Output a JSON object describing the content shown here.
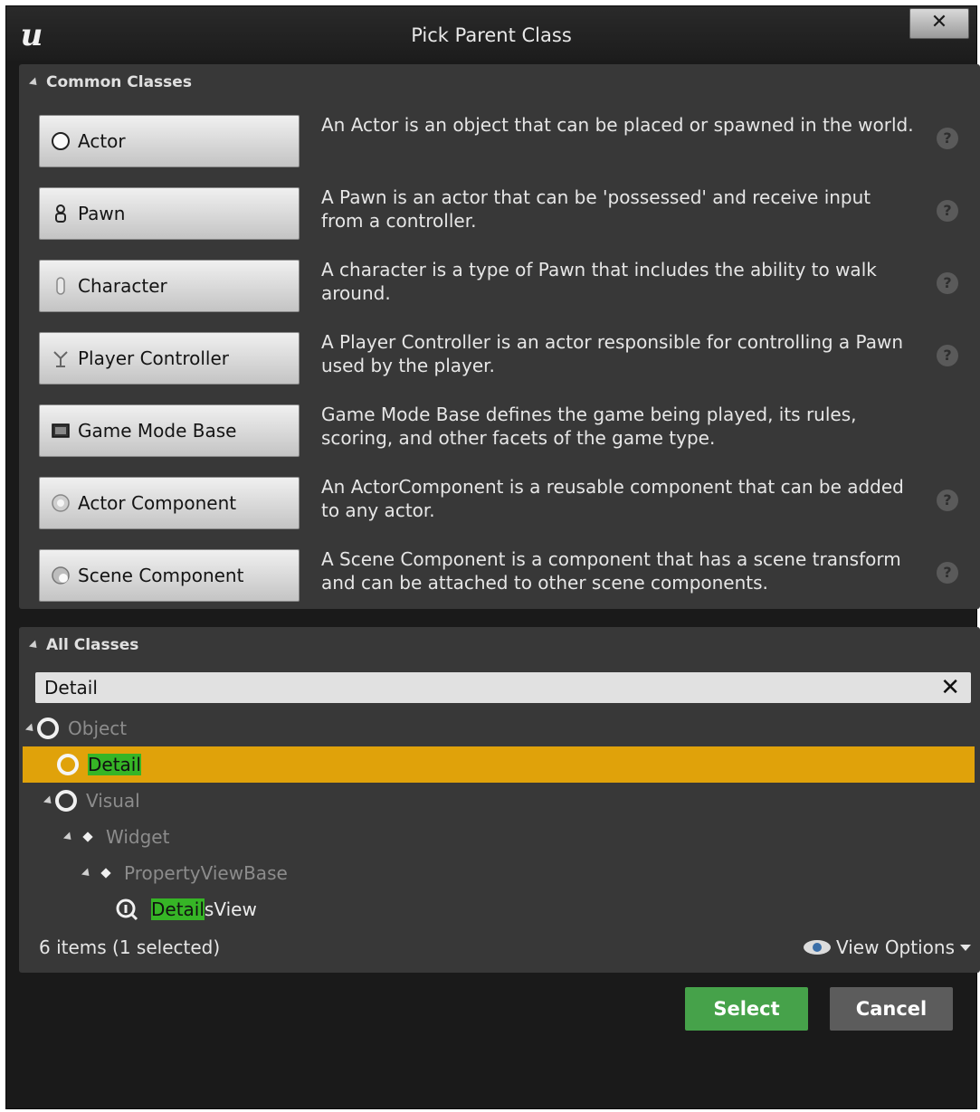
{
  "window": {
    "title": "Pick Parent Class",
    "close_label": "✕",
    "logo_glyph": "u"
  },
  "common": {
    "header": "Common Classes",
    "classes": [
      {
        "label": "Actor",
        "icon": "sphere-icon",
        "description": "An Actor is an object that can be placed or spawned in the world.",
        "help": true
      },
      {
        "label": "Pawn",
        "icon": "pawn-icon",
        "description": "A Pawn is an actor that can be 'possessed' and receive input from a controller.",
        "help": true
      },
      {
        "label": "Character",
        "icon": "character-icon",
        "description": "A character is a type of Pawn that includes the ability to walk around.",
        "help": true
      },
      {
        "label": "Player Controller",
        "icon": "controller-icon",
        "description": "A Player Controller is an actor responsible for controlling a Pawn used by the player.",
        "help": true
      },
      {
        "label": "Game Mode Base",
        "icon": "game-mode-icon",
        "description": "Game Mode Base defines the game being played, its rules, scoring, and other facets of the game type.",
        "help": false
      },
      {
        "label": "Actor Component",
        "icon": "actor-component-icon",
        "description": "An ActorComponent is a reusable component that can be added to any actor.",
        "help": true
      },
      {
        "label": "Scene Component",
        "icon": "scene-component-icon",
        "description": "A Scene Component is a component that has a scene transform and can be attached to other scene components.",
        "help": true
      }
    ],
    "help_glyph": "?"
  },
  "all": {
    "header": "All Classes",
    "search_value": "Detail",
    "clear_glyph": "✕",
    "tree": {
      "object": "Object",
      "detail": "Detail",
      "visual": "Visual",
      "widget": "Widget",
      "property_view_base": "PropertyViewBase",
      "details_view_match": "Detail",
      "details_view_rest": "sView"
    },
    "status": "6 items (1 selected)",
    "view_options": "View Options"
  },
  "actions": {
    "select": "Select",
    "cancel": "Cancel"
  },
  "colors": {
    "selection": "#e0a20a",
    "match_highlight": "#36b526",
    "select_button": "#46a24a"
  }
}
